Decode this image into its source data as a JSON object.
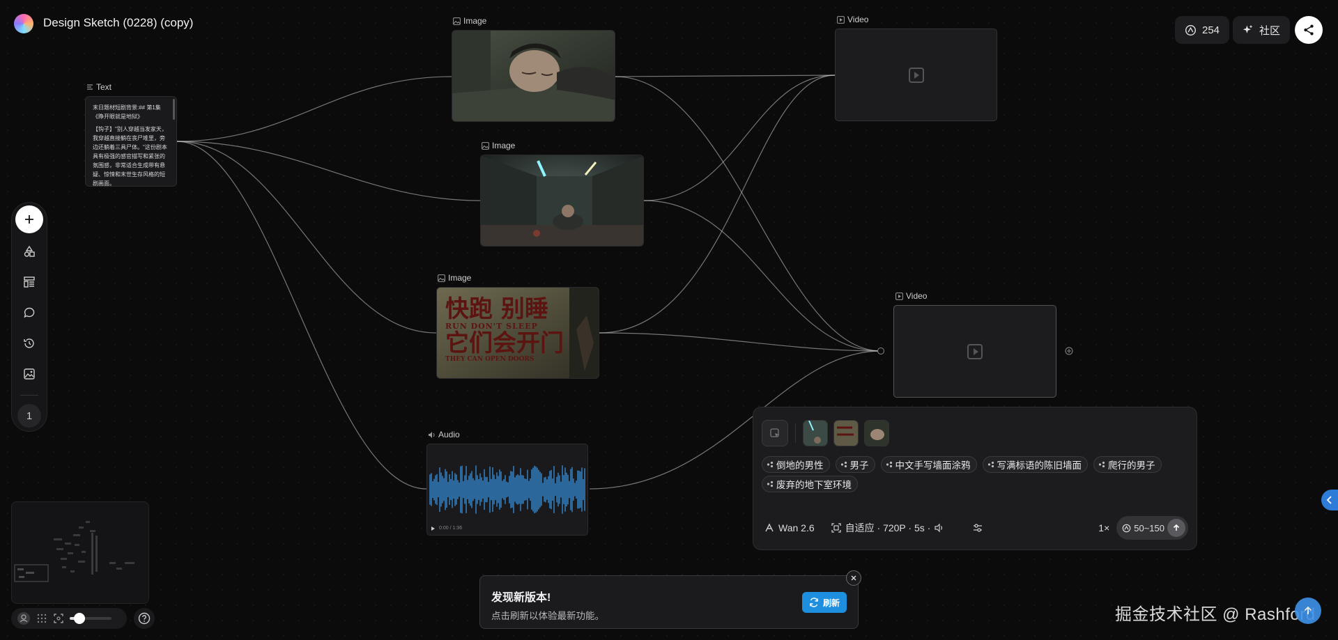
{
  "header": {
    "title": "Design Sketch (0228) (copy)",
    "credits": "254",
    "community_label": "社区"
  },
  "nodes": {
    "text_label": "Text",
    "text_title": "末日题材短剧背景:## 第1集《睁开眼就是地狱》",
    "text_body": "【钩子】\"别人穿越当发家天，我穿越直接躺在丧尸堆里，旁边还躺着三具尸体。\"这份剧本具有极强的感官描写和紧张的氛围感，非常适合生成带有悬疑、惊悚和末世生存风格的短剧画面。",
    "image_label": "Image",
    "video_label": "Video",
    "audio_label": "Audio",
    "audio_time": "0:00 / 1:36",
    "poster_text": {
      "line1": "快跑 别睡",
      "line2": "RUN   DON'T SLEEP",
      "line3": "它们会开门",
      "line4": "THEY CAN OPEN DOORS"
    }
  },
  "toolbar": {
    "page_number": "1"
  },
  "panel": {
    "tags": [
      "倒地的男性",
      "男子",
      "中文手写墙面涂鸦",
      "写满标语的陈旧墙面",
      "爬行的男子",
      "废弃的地下室环境"
    ],
    "model": "Wan 2.6",
    "settings": "自适应 · 720P · 5s ·",
    "multiplier": "1×",
    "cost": "50~150"
  },
  "toast": {
    "title": "发现新版本!",
    "body": "点击刷新以体验最新功能。",
    "refresh_label": "刷新"
  },
  "watermark": "掘金技术社区 @ Rashford",
  "colors": {
    "accent": "#1e8fde",
    "waveform": "#3a9bf0",
    "background": "#0b0b0c"
  }
}
